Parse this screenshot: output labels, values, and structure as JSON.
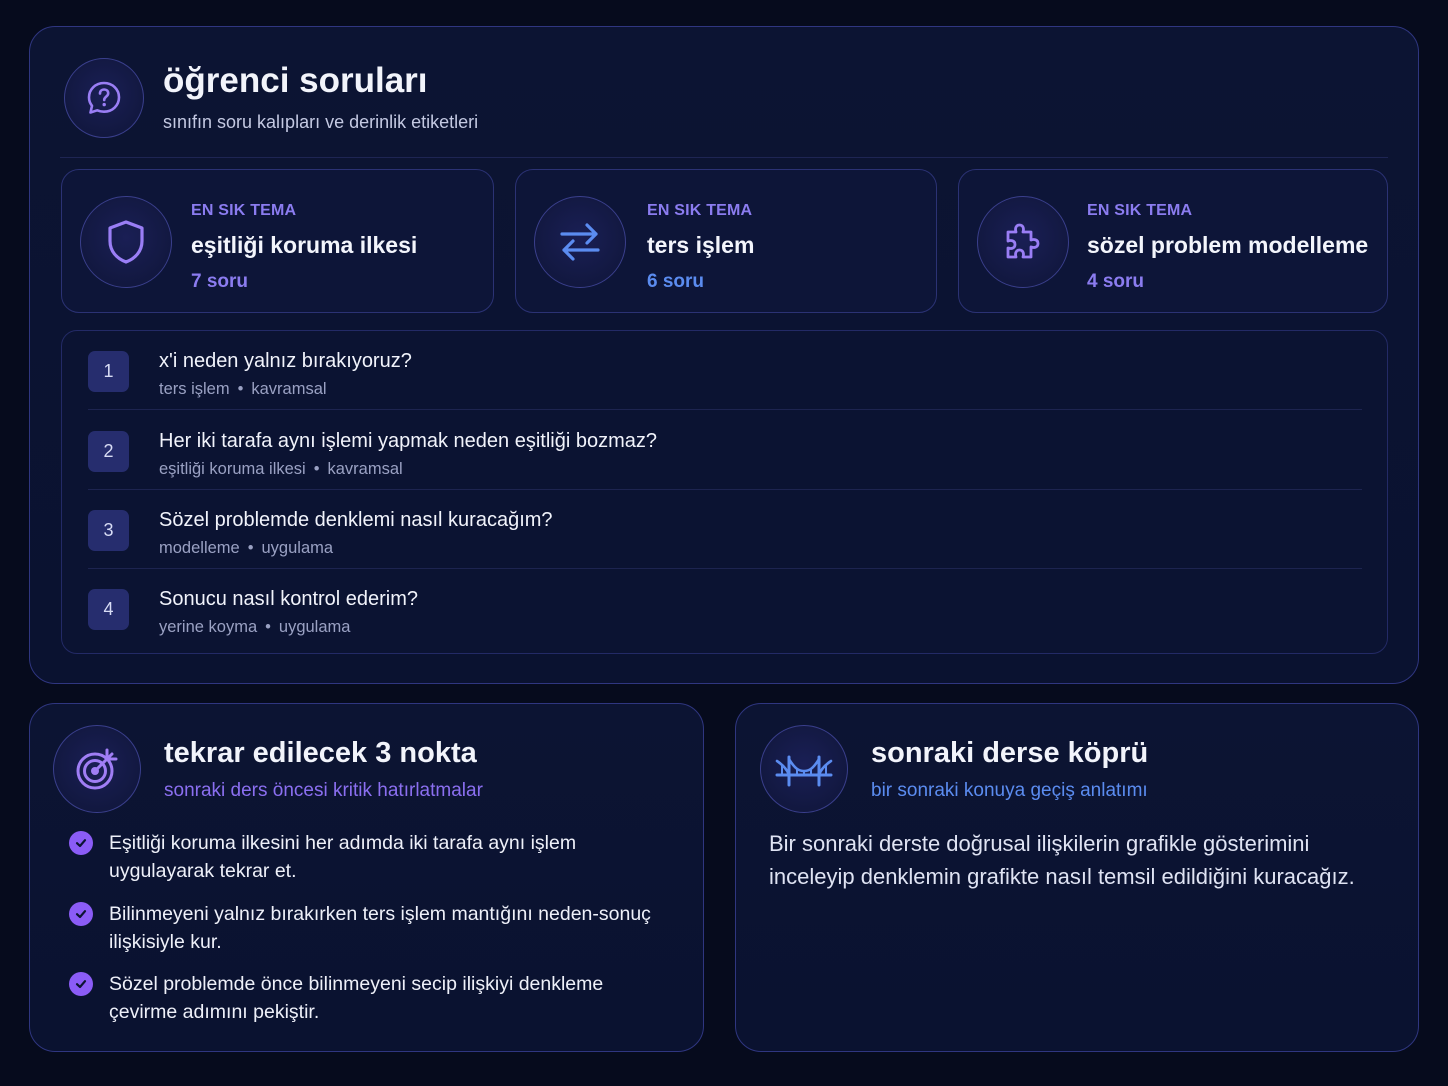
{
  "header": {
    "title": "öğrenci soruları",
    "subtitle": "sınıfın soru kalıpları ve derinlik etiketleri",
    "icon": "question-bubble-icon"
  },
  "themes": [
    {
      "label": "EN SIK TEMA",
      "name": "eşitliği koruma ilkesi",
      "count": "7 soru",
      "icon": "shield-icon",
      "accent": "#8b7cf0"
    },
    {
      "label": "EN SIK TEMA",
      "name": "ters işlem",
      "count": "6 soru",
      "icon": "swap-arrows-icon",
      "accent": "#5b8cf0"
    },
    {
      "label": "EN SIK TEMA",
      "name": "sözel problem modelleme",
      "count": "4 soru",
      "icon": "puzzle-icon",
      "accent": "#8b7cf0"
    }
  ],
  "questions": [
    {
      "num": "1",
      "text": "x'i neden yalnız bırakıyoruz?",
      "tag1": "ters işlem",
      "tag2": "kavramsal"
    },
    {
      "num": "2",
      "text": "Her iki tarafa aynı işlemi yapmak neden eşitliği bozmaz?",
      "tag1": "eşitliği koruma ilkesi",
      "tag2": "kavramsal"
    },
    {
      "num": "3",
      "text": "Sözel problemde denklemi nasıl kuracağım?",
      "tag1": "modelleme",
      "tag2": "uygulama"
    },
    {
      "num": "4",
      "text": "Sonucu nasıl kontrol ederim?",
      "tag1": "yerine koyma",
      "tag2": "uygulama"
    }
  ],
  "tag_separator": "•",
  "review": {
    "title": "tekrar edilecek 3 nokta",
    "subtitle": "sonraki ders öncesi kritik hatırlatmalar",
    "icon": "target-icon",
    "items": [
      "Eşitliği koruma ilkesini her adımda iki tarafa aynı işlem uygulayarak tekrar et.",
      "Bilinmeyeni yalnız bırakırken ters işlem mantığını neden-sonuç ilişkisiyle kur.",
      "Sözel problemde önce bilinmeyeni secip ilişkiyi denkleme çevirme adımını pekiştir."
    ]
  },
  "bridge": {
    "title": "sonraki derse köprü",
    "subtitle": "bir sonraki konuya geçiş anlatımı",
    "icon": "bridge-icon",
    "text": "Bir sonraki derste doğrusal ilişkilerin grafikle gösterimini inceleyip denklemin grafikte nasıl temsil edildiğini kuracağız."
  },
  "colors": {
    "background": "#060b1d",
    "panel_border": "#2f3680",
    "accent_purple": "#8b7cf0",
    "accent_blue": "#5b8cf0",
    "check": "#8b5cf6"
  }
}
